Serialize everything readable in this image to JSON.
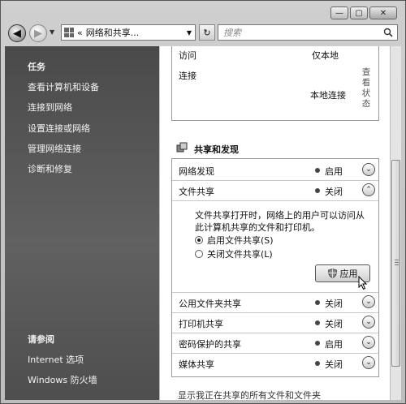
{
  "window": {
    "caption_buttons": [
      "—",
      "▢",
      "✕"
    ]
  },
  "nav": {
    "address_prefix": "«",
    "address_text": "网络和共享...",
    "search_placeholder": "搜索"
  },
  "sidebar": {
    "tasks_heading": "任务",
    "tasks": [
      "查看计算机和设备",
      "连接到网络",
      "设置连接或网络",
      "管理网络连接",
      "诊断和修复"
    ],
    "see_also_heading": "请参阅",
    "see_also": [
      "Internet 选项",
      "Windows 防火墙"
    ]
  },
  "network_panel": {
    "access_label": "访问",
    "access_value": "仅本地",
    "connection_label": "连接",
    "connection_value": "本地连接",
    "view_status_link": [
      "查",
      "看",
      "状",
      "态"
    ]
  },
  "sharing": {
    "heading": "共享和发现",
    "rows": [
      {
        "label": "网络发现",
        "status": "启用",
        "chevron": "⌄"
      },
      {
        "label": "文件共享",
        "status": "关闭",
        "chevron": "⌃"
      },
      {
        "label": "公用文件夹共享",
        "status": "关闭",
        "chevron": "⌄"
      },
      {
        "label": "打印机共享",
        "status": "关闭",
        "chevron": "⌄"
      },
      {
        "label": "密码保护的共享",
        "status": "启用",
        "chevron": "⌄"
      },
      {
        "label": "媒体共享",
        "status": "关闭",
        "chevron": "⌄"
      }
    ],
    "file_sharing_desc_line1": "文件共享打开时，网络上的用户可以访问从",
    "file_sharing_desc_line2": "此计算机共享的文件和打印机。",
    "option_on": "启用文件共享(S)",
    "option_off": "关闭文件共享(L)",
    "selected_option": "启用文件共享(S)",
    "apply_label": "应用"
  },
  "footer_link": "显示我正在共享的所有文件和文件夹",
  "colors": {
    "sidebar_bg": "#555555",
    "panel_border": "#999999"
  }
}
